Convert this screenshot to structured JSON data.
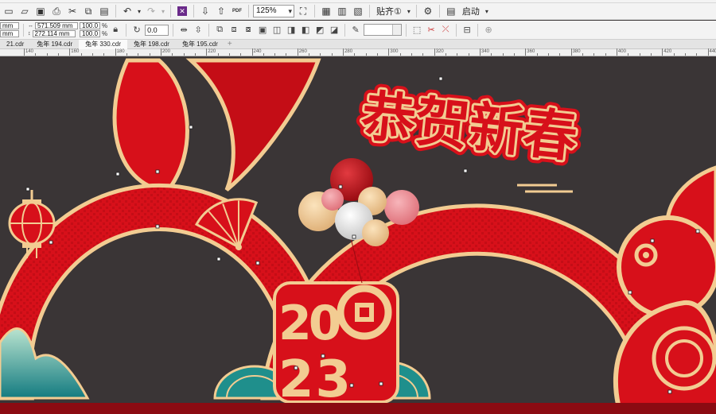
{
  "toolbar": {
    "zoom_value": "125%",
    "snap_label": "贴齐①",
    "launch_label": "启动"
  },
  "propbar": {
    "pos_x_unit": "mm",
    "pos_y_unit": "mm",
    "width_value": "571.509 mm",
    "height_value": "272.114 mm",
    "scale_x": "100.0",
    "scale_y": "100.0",
    "percent": "%",
    "rotation_value": "0.0"
  },
  "tabs": [
    {
      "label": "21.cdr"
    },
    {
      "label": "兔年 194.cdr"
    },
    {
      "label": "兔年 330.cdr"
    },
    {
      "label": "兔年 198.cdr"
    },
    {
      "label": "兔年 195.cdr"
    }
  ],
  "ruler": {
    "ticks": [
      "140",
      "160",
      "180",
      "200",
      "220",
      "240",
      "260",
      "280",
      "300",
      "320",
      "340",
      "360",
      "380",
      "400",
      "420",
      "440"
    ]
  },
  "artwork": {
    "headline": "恭贺新春",
    "year_top": "20",
    "year_bottom": "23"
  },
  "colors": {
    "red": "#d7101a",
    "dark_red": "#a60d14",
    "gold": "#f2cc92",
    "canvas": "#3a3536",
    "teal": "#1f8f8c"
  }
}
